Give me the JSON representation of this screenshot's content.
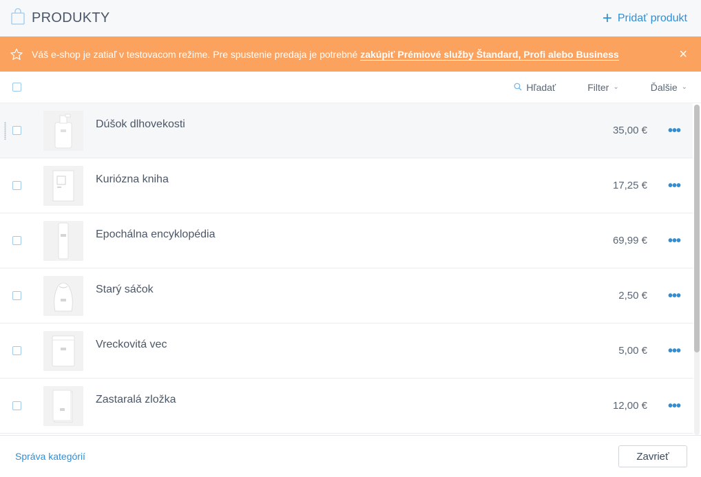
{
  "header": {
    "title": "PRODUKTY",
    "add_label": "Pridať produkt",
    "icon": "shopping-bag-icon"
  },
  "banner": {
    "text": "Váš e-shop je zatiaľ v testovacom režime. Pre spustenie predaja je potrebné ",
    "link": "zakúpiť Prémiové služby Štandard, Profi alebo Business",
    "close": "×",
    "color": "#fba25f"
  },
  "toolbar": {
    "search_label": "Hľadať",
    "filter_label": "Filter",
    "more_label": "Ďalšie"
  },
  "products": [
    {
      "name": "Dúšok dlhovekosti",
      "price": "35,00 €"
    },
    {
      "name": "Kuriózna kniha",
      "price": "17,25 €"
    },
    {
      "name": "Epochálna encyklopédia",
      "price": "69,99 €"
    },
    {
      "name": "Starý sáčok",
      "price": "2,50 €"
    },
    {
      "name": "Vreckovitá vec",
      "price": "5,00 €"
    },
    {
      "name": "Zastaralá zložka",
      "price": "12,00 €"
    }
  ],
  "footer": {
    "categories_link": "Správa kategórií",
    "close_label": "Zavrieť"
  },
  "colors": {
    "accent": "#2f8fd6",
    "banner": "#fba25f"
  }
}
